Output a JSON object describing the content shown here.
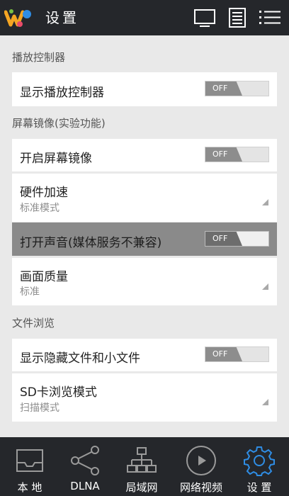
{
  "header": {
    "title": "设置",
    "icons": [
      "screen-icon",
      "document-icon",
      "list-menu-icon"
    ]
  },
  "sections": [
    {
      "title": "播放控制器",
      "items": [
        {
          "label": "显示播放控制器",
          "toggle": "OFF"
        }
      ]
    },
    {
      "title": "屏幕镜像(实验功能)",
      "items": [
        {
          "label": "开启屏幕镜像",
          "toggle": "OFF"
        },
        {
          "label": "硬件加速",
          "sub": "标准模式"
        },
        {
          "label": "打开声音(媒体服务不兼容)",
          "toggle": "OFF"
        },
        {
          "label": "画面质量",
          "sub": "标准"
        }
      ]
    },
    {
      "title": "文件浏览",
      "items": [
        {
          "label": "显示隐藏文件和小文件",
          "toggle": "OFF"
        },
        {
          "label": "SD卡浏览模式",
          "sub": "扫描模式"
        }
      ]
    }
  ],
  "bottom_nav": [
    {
      "label": "本 地",
      "icon": "inbox-icon"
    },
    {
      "label": "DLNA",
      "icon": "share-icon"
    },
    {
      "label": "局域网",
      "icon": "network-icon"
    },
    {
      "label": "网络视频",
      "icon": "play-circle-icon"
    },
    {
      "label": "设 置",
      "icon": "gear-icon",
      "active": true
    }
  ],
  "colors": {
    "topbar": "#25272b",
    "background": "#e9e9e9",
    "accent": "#2f8de4",
    "toggle_off": "#8d8d8d"
  }
}
